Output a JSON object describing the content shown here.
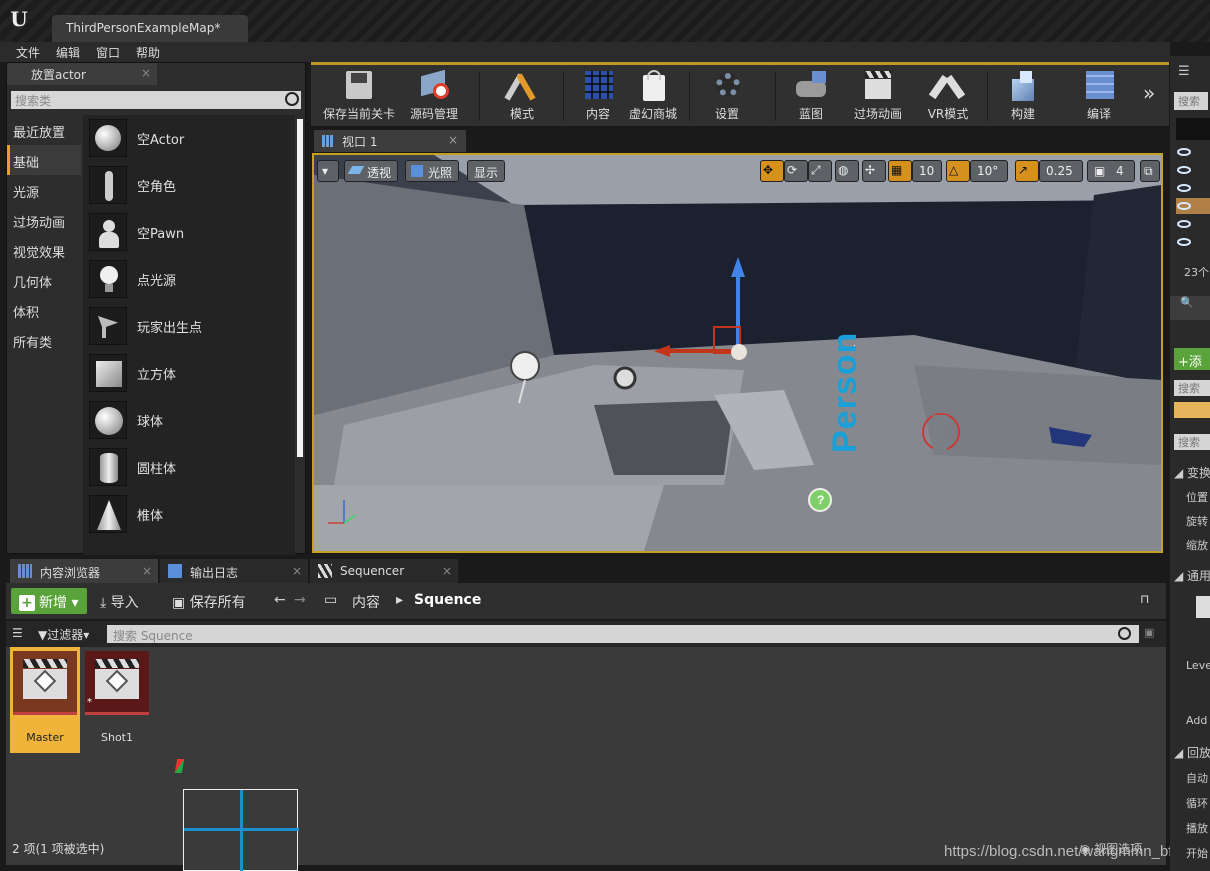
{
  "window": {
    "tab_title": "ThirdPersonExampleMap*"
  },
  "menu": [
    "文件",
    "编辑",
    "窗口",
    "帮助"
  ],
  "place_panel": {
    "tab": "放置actor",
    "search_placeholder": "搜索类",
    "categories": [
      "最近放置",
      "基础",
      "光源",
      "过场动画",
      "视觉效果",
      "几何体",
      "体积",
      "所有类"
    ],
    "selected_category": "基础",
    "items": [
      "空Actor",
      "空角色",
      "空Pawn",
      "点光源",
      "玩家出生点",
      "立方体",
      "球体",
      "圆柱体",
      "椎体"
    ]
  },
  "toolbar": {
    "buttons": [
      "保存当前关卡",
      "源码管理",
      "模式",
      "内容",
      "虚幻商城",
      "设置",
      "蓝图",
      "过场动画",
      "VR模式",
      "构建",
      "编译"
    ]
  },
  "viewport": {
    "tab": "视口 1",
    "perspective": "透视",
    "lit": "光照",
    "show": "显示",
    "grid_snap": "10",
    "rot_snap": "10°",
    "scale_snap": "0.25",
    "cam_speed": "4",
    "floor_text": "Person"
  },
  "bottom_tabs": [
    "内容浏览器",
    "输出日志",
    "Sequencer"
  ],
  "content_browser": {
    "new_label": "新增",
    "import_label": "导入",
    "save_all_label": "保存所有",
    "path": [
      "内容",
      "Squence"
    ],
    "filter_label": "过滤器",
    "search_placeholder": "搜索 Squence",
    "assets": [
      {
        "name": "Master",
        "selected": true
      },
      {
        "name": "Shot1",
        "selected": false
      }
    ],
    "status": "2 项(1 项被选中)",
    "view_options": "视图选项"
  },
  "right_panel": {
    "search": "搜索",
    "count": "23个",
    "add": "添",
    "search2": "搜索",
    "search3": "搜索",
    "section_transform": "变换",
    "row_location": "位置",
    "row_rotation": "旋转",
    "row_scale": "缩放",
    "section_common": "通用",
    "level_label": "Leve",
    "add_label": "Add",
    "section_playback": "回放",
    "row_auto": "自动",
    "row_loop": "循环",
    "row_play": "播放",
    "row_end": "开始"
  },
  "watermark": "https://blog.csdn.net/wangmmn_bfox",
  "colors": {
    "accent": "#f1b43a",
    "new_button": "#5aa23a",
    "toolbar_border": "#c09a25"
  }
}
